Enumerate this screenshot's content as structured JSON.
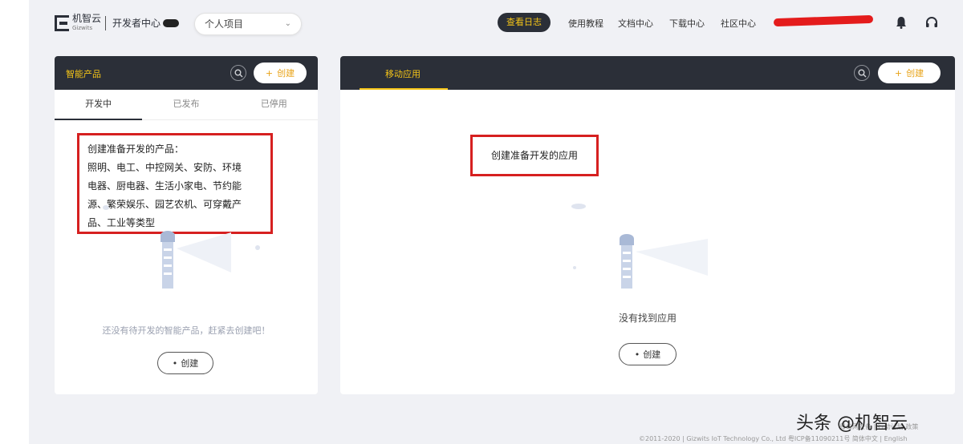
{
  "header": {
    "brand_name": "机智云",
    "brand_sub": "Gizwits",
    "dev_center": "开发者中心",
    "project_select": {
      "value": "个人项目"
    },
    "nav": {
      "pill": "查看日志",
      "links": [
        "使用教程",
        "文档中心",
        "下载中心",
        "社区中心"
      ]
    }
  },
  "left_panel": {
    "title": "智能产品",
    "create_label": "创建",
    "tabs": [
      "开发中",
      "已发布",
      "已停用"
    ],
    "annotation": {
      "line1": "创建准备开发的产品：",
      "line2": "照明、电工、中控网关、安防、环境",
      "line3": "电器、厨电器、生活小家电、节约能",
      "line4": "源、繁荣娱乐、园艺农机、可穿戴产",
      "line5": "品、工业等类型"
    },
    "empty_text": "还没有待开发的智能产品，赶紧去创建吧！",
    "empty_create_label": "创建"
  },
  "right_panel": {
    "tab": "移动应用",
    "create_label": "创建",
    "annotation": "创建准备开发的应用",
    "empty_text": "没有找到应用",
    "empty_create_label": "创建"
  },
  "footer": {
    "copyright": "©2011-2020 | Gizwits IoT Technology Co., Ltd 粤ICP备11090211号 简体中文 | English",
    "top_line": "粤公网安备 | 行动计划 政策"
  },
  "watermark": "头条 @机智云",
  "colors": {
    "dark": "#2b2f38",
    "accent": "#f5c518",
    "annotation": "#d62020",
    "background": "#f0f1f5"
  }
}
